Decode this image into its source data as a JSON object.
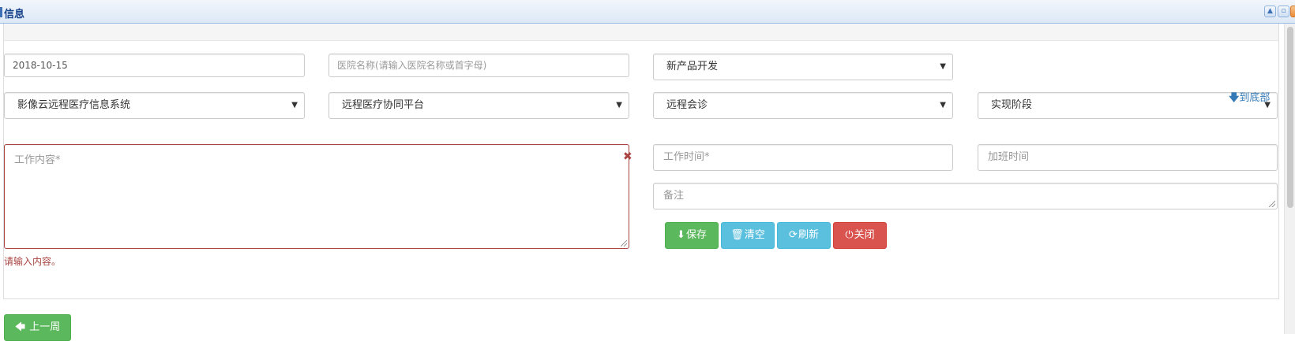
{
  "window": {
    "title": "信息",
    "controls": [
      "collapse-icon",
      "restore-icon",
      "close-icon"
    ]
  },
  "form": {
    "date": {
      "value": "2018-10-15"
    },
    "hospital": {
      "placeholder": "医院名称(请输入医院名称或首字母)"
    },
    "category_select": {
      "selected": "新产品开发"
    },
    "system_select": {
      "selected": "影像云远程医疗信息系统"
    },
    "platform_select": {
      "selected": "远程医疗协同平台"
    },
    "module_select": {
      "selected": "远程会诊"
    },
    "stage_select": {
      "selected": "实现阶段"
    },
    "work_content": {
      "placeholder": "工作内容*",
      "error": "请输入内容。"
    },
    "work_time": {
      "placeholder": "工作时间*"
    },
    "overtime": {
      "placeholder": "加班时间"
    },
    "remark": {
      "placeholder": "备注"
    }
  },
  "links": {
    "to_bottom": "到底部"
  },
  "actions": {
    "save": "保存",
    "clear": "清空",
    "refresh": "刷新",
    "close": "关闭",
    "prev_week": "上一周"
  },
  "colors": {
    "success": "#5cb85c",
    "info": "#5bc0de",
    "danger": "#d9534f",
    "error": "#a94442",
    "link": "#337ab7",
    "title": "#15428b"
  }
}
